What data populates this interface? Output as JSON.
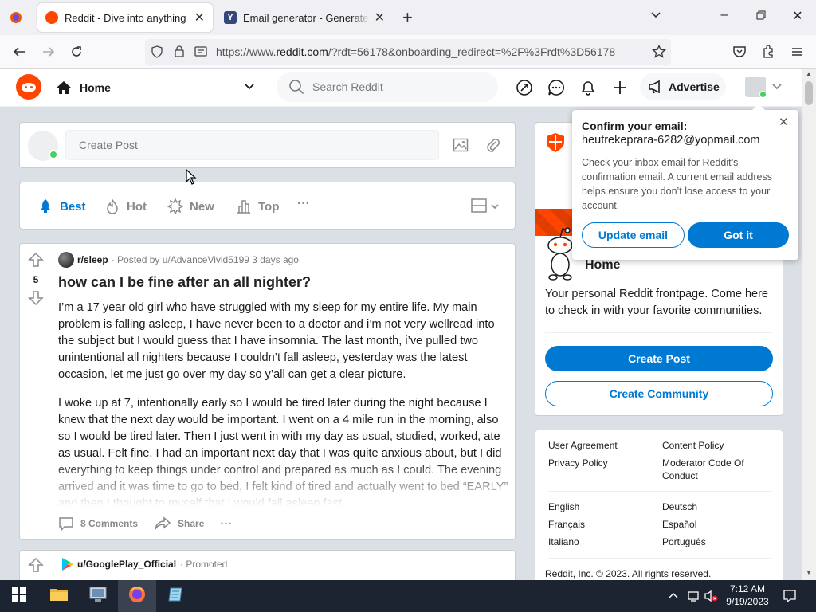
{
  "browser": {
    "tabs": [
      {
        "label": "Reddit - Dive into anything",
        "active": true
      },
      {
        "label": "Email generator - Generate a te",
        "active": false
      }
    ],
    "url_prefix": "https://www.",
    "url_host": "reddit.com",
    "url_rest": "/?rdt=56178&onboarding_redirect=%2F%3Frdt%3D56178"
  },
  "header": {
    "feed_label": "Home",
    "search_placeholder": "Search Reddit",
    "advertise_label": "Advertise"
  },
  "create_post": {
    "placeholder": "Create Post"
  },
  "sort": {
    "options": [
      "Best",
      "Hot",
      "New",
      "Top"
    ],
    "active": "Best",
    "more": "···"
  },
  "post": {
    "subreddit": "r/sleep",
    "meta": "· Posted by u/AdvanceVivid5199 3 days ago",
    "votes": "5",
    "title": "how can I be fine after an all nighter?",
    "paragraphs": [
      "I’m a 17 year old girl who have struggled with my sleep for my entire life. My main problem is falling asleep, I have never been to a doctor and i’m not very wellread into the subject but I would guess that I have insomnia. The last month, i’ve pulled two unintentional all nighters because I couldn’t fall asleep, yesterday was the latest occasion, let me just go over my day so y’all can get a clear picture.",
      "I woke up at 7, intentionally early so I would be tired later during the night because I knew that the next day would be important. I went on a 4 mile run in the morning, also so I would be tired later. Then I just went in with my day as usual, studied, worked, ate as usual. Felt fine. I had an important next day that I was quite anxious about, but I did everything to keep things under control and prepared as much as I could. The evening arrived and it was time to go to bed, I felt kind of tired and actually went to bed “EARLY” and then I thought to myself that I would fall asleep fast"
    ],
    "comments_label": "8 Comments",
    "share_label": "Share",
    "more": "···"
  },
  "promo": {
    "user": "u/GooglePlay_Official",
    "tag": "· Promoted"
  },
  "home_card": {
    "title": "Home",
    "description": "Your personal Reddit frontpage. Come here to check in with your favorite communities.",
    "create_post": "Create Post",
    "create_community": "Create Community"
  },
  "footer": {
    "links": [
      "User Agreement",
      "Content Policy",
      "Privacy Policy",
      "Moderator Code Of Conduct"
    ],
    "languages": [
      "English",
      "Deutsch",
      "Français",
      "Español",
      "Italiano",
      "Português"
    ],
    "copyright": "Reddit, Inc. © 2023. All rights reserved."
  },
  "popup": {
    "heading": "Confirm your email:",
    "email": "heutrekeprara-6282@yopmail.com",
    "body": "Check your inbox email for Reddit’s confirmation email. A current email address helps ensure you don’t lose access to your account.",
    "update_button": "Update email",
    "got_it_button": "Got it"
  },
  "taskbar": {
    "time": "7:12 AM",
    "date": "9/19/2023"
  },
  "colors": {
    "reddit_orange": "#ff4500",
    "reddit_blue": "#0079d3",
    "taskbar": "#1c2331",
    "page_bg": "#dae0e6"
  }
}
